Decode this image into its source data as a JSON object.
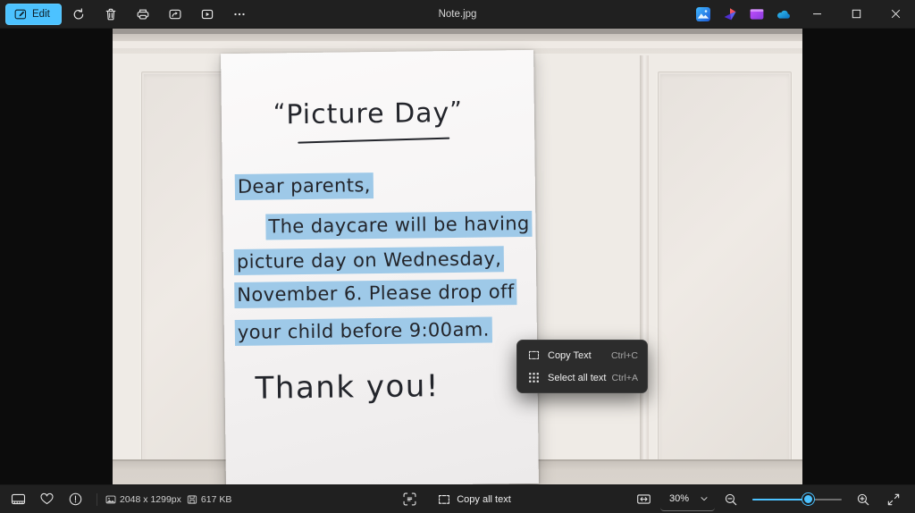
{
  "window": {
    "title": "Note.jpg",
    "accent_color": "#4cc2ff",
    "chrome_color": "#202020"
  },
  "toolbar": {
    "edit_label": "Edit",
    "buttons": [
      {
        "name": "rotate-button",
        "icon": "rotate-icon",
        "tooltip": "Rotate"
      },
      {
        "name": "delete-button",
        "icon": "trash-icon",
        "tooltip": "Delete"
      },
      {
        "name": "print-button",
        "icon": "printer-icon",
        "tooltip": "Print"
      },
      {
        "name": "share-button",
        "icon": "share-icon",
        "tooltip": "Share"
      },
      {
        "name": "slideshow-button",
        "icon": "slideshow-icon",
        "tooltip": "Slideshow"
      },
      {
        "name": "more-button",
        "icon": "ellipsis-icon",
        "tooltip": "See more"
      }
    ],
    "app_icons": [
      {
        "name": "photos-app-icon",
        "label": "Photos"
      },
      {
        "name": "designer-app-icon",
        "label": "Designer"
      },
      {
        "name": "clipchamp-app-icon",
        "label": "Clipchamp"
      },
      {
        "name": "onedrive-app-icon",
        "label": "OneDrive"
      }
    ],
    "window_controls": {
      "minimize": "—",
      "maximize": "□",
      "close": "✕"
    }
  },
  "photo": {
    "note": {
      "title": "Picture Day",
      "quote_open": "“",
      "quote_close": "”",
      "lines": [
        "Dear parents,",
        "The daycare will be having",
        "picture day on Wednesday,",
        "November 6. Please drop off",
        "your child before 9:00am."
      ],
      "closing": "Thank you!"
    },
    "highlight_color": "#9ec9e8",
    "ink_color": "#23252b"
  },
  "context_menu": {
    "items": [
      {
        "label": "Copy Text",
        "accel": "Ctrl+C",
        "icon": "copy-text-icon"
      },
      {
        "label": "Select all text",
        "accel": "Ctrl+A",
        "icon": "select-all-text-icon"
      }
    ]
  },
  "statusbar": {
    "filmstrip_label": "Filmstrip",
    "favorite_label": "Add to favorites",
    "info_label": "File info",
    "dimensions": "2048 x 1299px",
    "filesize": "617 KB",
    "scan_label": "Scan text",
    "copy_all_text": "Copy all text",
    "fit_label": "Fit to window",
    "zoom_level": "30%",
    "zoom_out_label": "Zoom out",
    "zoom_in_label": "Zoom in",
    "fullscreen_label": "Full screen",
    "slider_value": 62
  }
}
